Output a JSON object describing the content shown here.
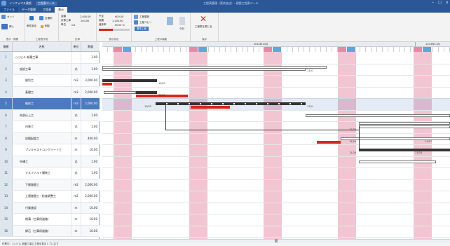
{
  "app": {
    "title": "インフォマス建設",
    "context_tab": "工程表ツール",
    "caption": "工程表管理（東京支店）- 建設工程表ツール"
  },
  "window_buttons": [
    "‒",
    "□",
    "×"
  ],
  "tabs": [
    "ファイル",
    "データ管理",
    "工程表",
    "表示"
  ],
  "help": "ヘルプ（F1の使用）",
  "ribbon": {
    "groups": [
      {
        "label": "表示・期間"
      },
      {
        "label": "工程表作成"
      },
      {
        "label": "計算"
      },
      {
        "label": "表示設定"
      },
      {
        "label": "工程の編集"
      },
      {
        "label": "保存"
      }
    ],
    "buttons": {
      "cut": "カット",
      "insert": "挿入",
      "setting": "条件設定",
      "all_select": "全選択",
      "delete_row": "削除",
      "update": "工程更新",
      "copy": "工程コピー",
      "base": "基準工程",
      "today": "今日",
      "close": "工程表を閉じる"
    },
    "metrics": {
      "l1": "金額",
      "v1": "2,000.00",
      "l2": "計算工事",
      "v2": "200.00",
      "l3": "単位",
      "v3": "m2",
      "l4": "予定",
      "v4": "600.00",
      "l5": "実績",
      "v5": "1,200.00",
      "l6": "進捗率",
      "v6": "45.00 %"
    }
  },
  "columns": [
    "階層",
    "名称",
    "単位",
    "数量"
  ],
  "rows": [
    {
      "no": "1",
      "name": "○○ビル 新築工事",
      "unit": "",
      "qty": "1.00"
    },
    {
      "no": "2",
      "name": "仮設工事",
      "unit": "式",
      "qty": "1.00"
    },
    {
      "no": "3",
      "name": "根切工",
      "unit": "m3",
      "qty": "3,000.00"
    },
    {
      "no": "4",
      "name": "基礎工",
      "unit": "m3",
      "qty": "2,000.00"
    },
    {
      "no": "5",
      "name": "躯体工",
      "unit": "m3",
      "qty": "2,000.00"
    },
    {
      "no": "6",
      "name": "外部仕上工",
      "unit": "式",
      "qty": "1.00"
    },
    {
      "no": "7",
      "name": "内装工",
      "unit": "式",
      "qty": "1.00"
    },
    {
      "no": "8",
      "name": "設備配管工",
      "unit": "m",
      "qty": "400.00"
    },
    {
      "no": "9",
      "name": "プレキャストコンクリート工",
      "unit": "m",
      "qty": "10.00"
    },
    {
      "no": "10",
      "name": "外構工",
      "unit": "式",
      "qty": "1.00"
    },
    {
      "no": "11",
      "name": "アスファルト舗装工",
      "unit": "式",
      "qty": "1.00"
    },
    {
      "no": "12",
      "name": "下層路盤工",
      "unit": "m2",
      "qty": "2,000.00"
    },
    {
      "no": "13",
      "name": "上層路盤工・粒度調整工",
      "unit": "m2",
      "qty": "2,000.00"
    },
    {
      "no": "14",
      "name": "付属施設",
      "unit": "m",
      "qty": "10.00"
    },
    {
      "no": "15",
      "name": "側溝（工事用道路）",
      "unit": "m",
      "qty": "10.00"
    },
    {
      "no": "16",
      "name": "縁石（工事用道路）",
      "unit": "m",
      "qty": "10.00"
    }
  ],
  "gantt": {
    "months": [
      "",
      "2014年10月",
      "2014年11月"
    ],
    "labels": [
      "11/4",
      "10/21",
      "10/21",
      "10/22",
      "11/4",
      "11/20",
      "11/20",
      "11/27",
      "11/20",
      "11/24"
    ]
  },
  "status": "作業中：○○ビル 新築工事の工程を表示しています",
  "colors": {
    "title": "#2b5797",
    "weekend": "#f1c6d2",
    "progress": "#d7261e",
    "selected": "#4a7bbf"
  }
}
